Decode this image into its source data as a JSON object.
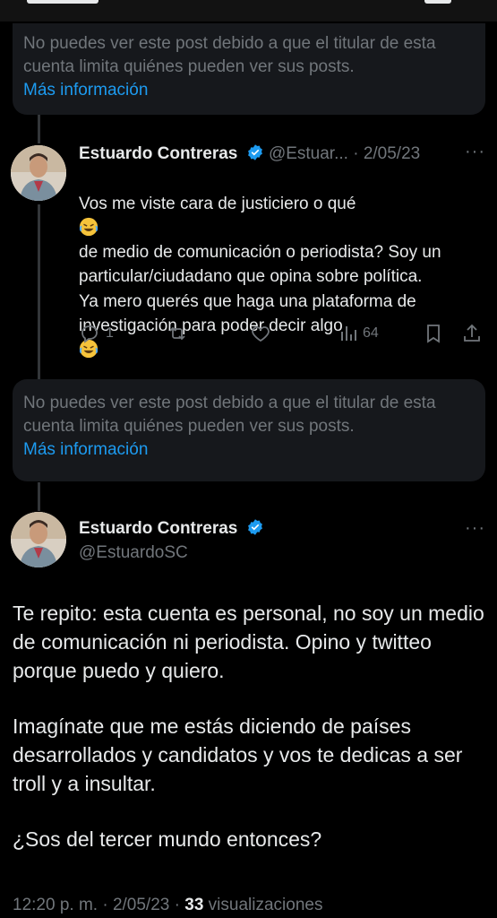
{
  "notice_top": {
    "text": "No puedes ver este post debido a que el titular de esta cuenta limita quiénes pueden ver sus posts.",
    "link": "Más información"
  },
  "reply": {
    "name": "Estuardo Contreras",
    "handle": "@Estuar...",
    "separator": "·",
    "date": "2/05/23",
    "text_1": "Vos me viste cara de justiciero o qué",
    "text_1b": "de medio de comunicación o periodista? Soy un particular/ciudadano que opina sobre política.",
    "text_2": "Ya mero querés que haga una plataforma de investigación para poder decir algo",
    "replies_count": "1",
    "views_count": "64"
  },
  "notice_mid": {
    "text": "No puedes ver este post debido a que el titular de esta cuenta limita quiénes pueden ver sus posts.",
    "link": "Más información"
  },
  "main_post": {
    "name": "Estuardo Contreras",
    "handle": "@EstuardoSC",
    "paragraph_1": "Te repito: esta cuenta es personal, no soy un medio de comunicación ni periodista. Opino y twitteo porque puedo y quiero.",
    "paragraph_2": "Imagínate que me estás diciendo de países desarrollados y candidatos y vos te dedicas a ser troll y a insultar.",
    "paragraph_3": "¿Sos del tercer mundo entonces?",
    "time": "12:20 p. m.",
    "sep1": "·",
    "date": "2/05/23",
    "sep2": "·",
    "views": "33",
    "views_label": "visualizaciones"
  },
  "colors": {
    "background": "#000000",
    "text": "#e7e9ea",
    "muted": "#71767b",
    "link": "#1d9bf0",
    "verified": "#1d9bf0",
    "notice_bg": "#16181c"
  },
  "icons": [
    "reply-icon",
    "retweet-icon",
    "like-icon",
    "views-icon",
    "bookmark-icon",
    "share-icon",
    "verified-badge-icon",
    "more-options-icon",
    "laughing-crying-emoji"
  ]
}
